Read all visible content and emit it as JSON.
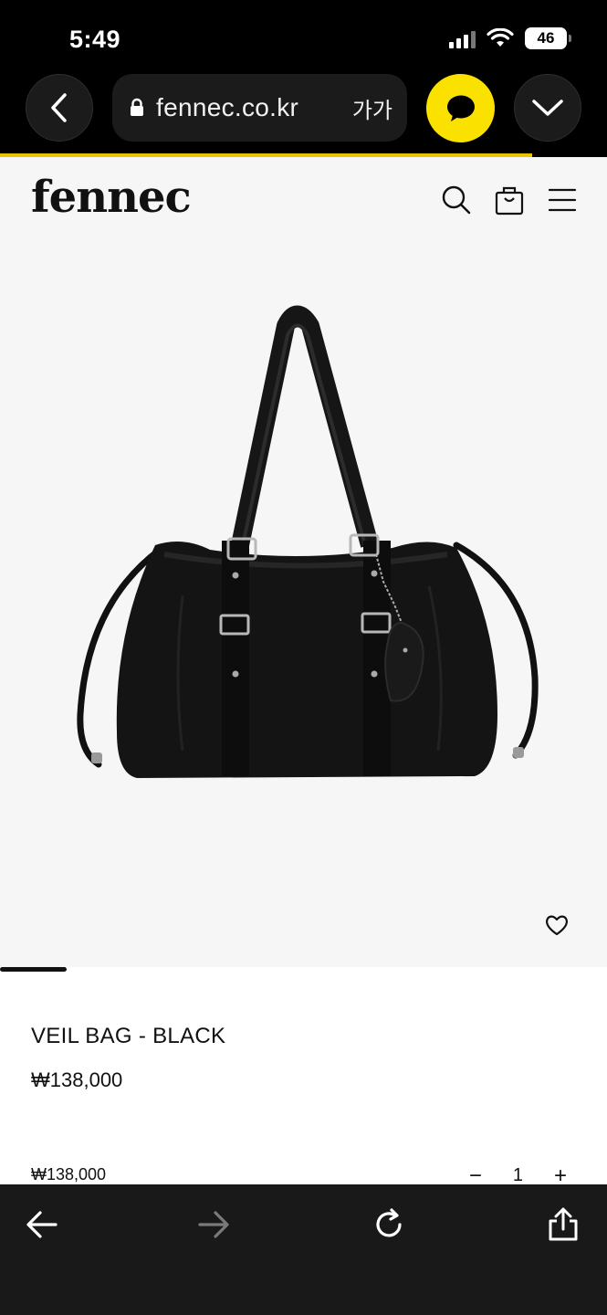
{
  "status_bar": {
    "time": "5:49",
    "battery": "46"
  },
  "browser": {
    "url": "fennec.co.kr",
    "text_size_label": "가가",
    "load_progress": 0.877,
    "accent_color": "#fae100"
  },
  "site": {
    "logo": "fennec",
    "icons": [
      "search-icon",
      "shopping-bag-icon",
      "menu-icon"
    ]
  },
  "product": {
    "name": "VEIL BAG - BLACK",
    "price": "₩138,000",
    "image_subject": "black nylon tote bag with leather straps and heart keychain",
    "gallery_position": 0.11
  },
  "order": {
    "subtotal": "₩138,000",
    "minus_label": "−",
    "quantity": "1",
    "plus_label": "+"
  },
  "toolbar": {
    "icons": [
      "back-arrow-icon",
      "forward-arrow-icon",
      "reload-icon",
      "share-icon"
    ]
  }
}
